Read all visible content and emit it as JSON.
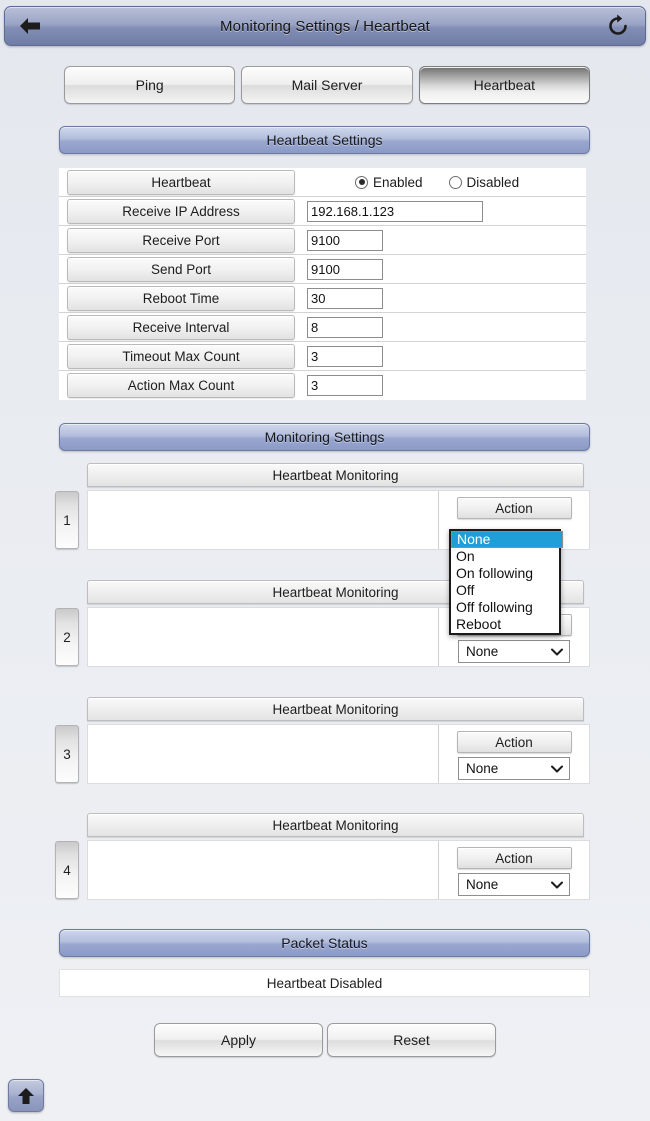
{
  "titlebar": {
    "title": "Monitoring Settings / Heartbeat",
    "back_icon": "back-arrow-icon",
    "refresh_icon": "refresh-icon"
  },
  "tabs": [
    {
      "label": "Ping",
      "active": false
    },
    {
      "label": "Mail Server",
      "active": false
    },
    {
      "label": "Heartbeat",
      "active": true
    }
  ],
  "heartbeat_settings": {
    "header": "Heartbeat Settings",
    "enable": {
      "label": "Heartbeat",
      "options": [
        "Enabled",
        "Disabled"
      ],
      "selected": "Enabled"
    },
    "fields": [
      {
        "label": "Receive IP Address",
        "value": "192.168.1.123",
        "width": "ip"
      },
      {
        "label": "Receive Port",
        "value": "9100",
        "width": "num"
      },
      {
        "label": "Send Port",
        "value": "9100",
        "width": "num"
      },
      {
        "label": "Reboot Time",
        "value": "30",
        "width": "num"
      },
      {
        "label": "Receive Interval",
        "value": "8",
        "width": "num"
      },
      {
        "label": "Timeout Max Count",
        "value": "3",
        "width": "num"
      },
      {
        "label": "Action Max Count",
        "value": "3",
        "width": "num"
      }
    ]
  },
  "monitoring_settings": {
    "header": "Monitoring Settings",
    "rows": [
      {
        "number": "1",
        "title": "Heartbeat Monitoring",
        "action_label": "Action",
        "action_value": "None"
      },
      {
        "number": "2",
        "title": "Heartbeat Monitoring",
        "action_label": "Action",
        "action_value": "None"
      },
      {
        "number": "3",
        "title": "Heartbeat Monitoring",
        "action_label": "Action",
        "action_value": "None"
      },
      {
        "number": "4",
        "title": "Heartbeat Monitoring",
        "action_label": "Action",
        "action_value": "None"
      }
    ],
    "open_dropdown": {
      "belongs_to_row": "1",
      "selected": "None",
      "options": [
        "None",
        "On",
        "On following",
        "Off",
        "Off following",
        "Reboot"
      ],
      "highlight_color": "#1f9fd8"
    }
  },
  "packet_status": {
    "header": "Packet Status",
    "message": "Heartbeat Disabled"
  },
  "footer": {
    "apply_label": "Apply",
    "reset_label": "Reset",
    "scroll_top_icon": "up-arrow-icon"
  }
}
